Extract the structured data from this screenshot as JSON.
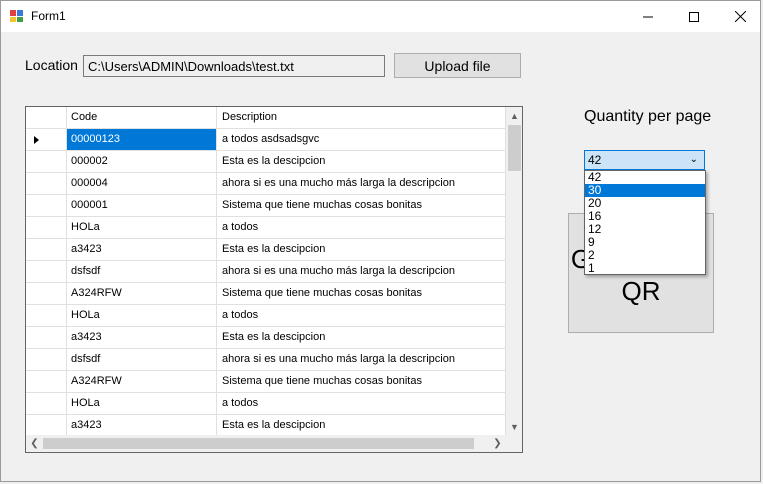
{
  "window": {
    "title": "Form1"
  },
  "location": {
    "label": "Location",
    "path": "C:\\Users\\ADMIN\\Downloads\\test.txt"
  },
  "upload": {
    "label": "Upload file"
  },
  "grid": {
    "headers": [
      "Code",
      "Description"
    ],
    "rows": [
      {
        "code": "00000123",
        "description": "a todos asdsadsgvc"
      },
      {
        "code": "000002",
        "description": "Esta es la descipcion"
      },
      {
        "code": "000004",
        "description": "ahora si es una mucho más larga la descripcion"
      },
      {
        "code": "000001",
        "description": "Sistema que tiene muchas cosas bonitas"
      },
      {
        "code": "HOLa",
        "description": "a todos"
      },
      {
        "code": "a3423",
        "description": "Esta es la descipcion"
      },
      {
        "code": "dsfsdf",
        "description": "ahora si es una mucho más larga la descripcion"
      },
      {
        "code": "A324RFW",
        "description": "Sistema que tiene muchas cosas bonitas"
      },
      {
        "code": "HOLa",
        "description": "a todos"
      },
      {
        "code": "a3423",
        "description": "Esta es la descipcion"
      },
      {
        "code": "dsfsdf",
        "description": "ahora si es una mucho más larga la descripcion"
      },
      {
        "code": "A324RFW",
        "description": "Sistema que tiene muchas cosas bonitas"
      },
      {
        "code": "HOLa",
        "description": "a todos"
      },
      {
        "code": "a3423",
        "description": "Esta es la descipcion"
      }
    ]
  },
  "quantity": {
    "label": "Quantity per page",
    "selected": "42",
    "options": [
      "42",
      "30",
      "20",
      "16",
      "12",
      "9",
      "2",
      "1"
    ],
    "highlighted": "30"
  },
  "generate": {
    "line1": "G",
    "line2": "QR"
  },
  "colors": {
    "selection": "#0078d7",
    "combo_bg": "#cce4f7"
  }
}
